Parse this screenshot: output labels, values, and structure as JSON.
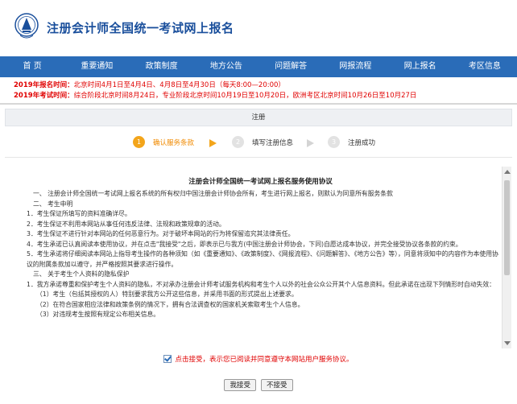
{
  "header": {
    "site_title": "注册会计师全国统一考试网上报名"
  },
  "nav": {
    "items": [
      "首 页",
      "重要通知",
      "政策制度",
      "地方公告",
      "问题解答",
      "网报流程",
      "网上报名",
      "考区信息"
    ]
  },
  "notice": {
    "reg_time_label": "2019年报名时间：",
    "reg_time_value": "北京时间4月1日至4月4日、4月8日至4月30日（每天8:00—20:00）",
    "exam_time_label": "2019年考试时间：",
    "exam_time_value": "综合阶段北京时间8月24日，专业阶段北京时间10月19日至10月20日，欧洲考区北京时间10月26日至10月27日"
  },
  "register": {
    "title": "注册"
  },
  "steps": [
    {
      "num": "1",
      "label": "确认服务条款"
    },
    {
      "num": "2",
      "label": "填写注册信息"
    },
    {
      "num": "3",
      "label": "注册成功"
    }
  ],
  "agreement": {
    "title": "注册会计师全国统一考试网上报名服务使用协议",
    "lines": [
      "一、 注册会计师全国统一考试网上报名系统的所有权归中国注册会计师协会所有，考生进行网上报名，则默认为同意所有服务条款",
      "二、 考生申明",
      "1．考生保证所填写的资料准确详尽。",
      "2．考生保证不利用本网站从事任何违反法律、法规和政策规章的活动。",
      "3．考生保证不进行针对本网站的任何恶意行为。对于破坏本网站的行为将保留追究其法律责任。",
      "4．考生承诺已认真阅读本使用协议，并在点击\"我接受\"之后，即表示已与我方(中国注册会计师协会，下同)自愿达成本协议，并完全接受协议各条款的约束。",
      "5．考生承诺将仔细阅读本网站上指导考生操作的各种须知（如《重要通知》、《政策制度》、《网报流程》、《问题解答》、《地方公告》等），同意将须知中的内容作为本使用协议的附属条款加以遵守，并严格按照其要求进行操作。",
      "三、 关于考生个人资料的隐私保护",
      "1．我方承诺尊重和保护考生个人资料的隐私，不对承办注册会计师考试服务机构和考生个人以外的社会公众公开其个人信息资料。但此承诺在出现下列情形时自动失效：",
      "（1）考生（包括其授权的人）特别要求我方公开这些信息，并采用书面的形式提出上述要求。",
      "（2）在符合国家相应法律和政策条例的情况下，拥有合法调查权的国家机关索取考生个人信息。",
      "（3）对违规考生按照有规定公布相关信息。"
    ]
  },
  "agree": {
    "text": "点击接受，表示您已阅读并同意遵守本网站用户服务协议。"
  },
  "buttons": {
    "accept": "我接受",
    "decline": "不接受"
  }
}
